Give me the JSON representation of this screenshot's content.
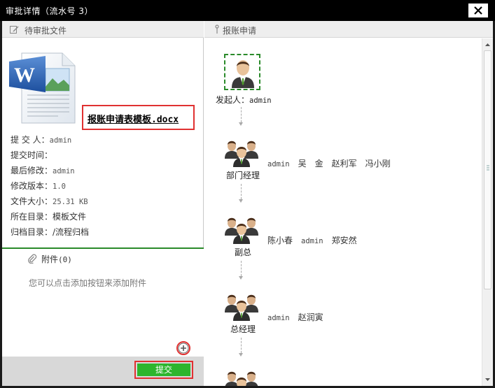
{
  "window": {
    "title": "审批详情（流水号 3）",
    "close_label": "✕"
  },
  "left_panel": {
    "header": "待审批文件",
    "file_name": "报账申请表模板.docx",
    "meta": [
      {
        "key": "提 交 人：",
        "value": "admin"
      },
      {
        "key": "提交时间：",
        "value": ""
      },
      {
        "key": "最后修改：",
        "value": "admin"
      },
      {
        "key": "修改版本：",
        "value": "1.0"
      },
      {
        "key": "文件大小：",
        "value": "25.31 KB"
      },
      {
        "key": "所在目录：",
        "value": "模板文件"
      },
      {
        "key": "归档目录：",
        "value": "/流程归档"
      }
    ],
    "attachments": {
      "title": "附件",
      "count": "(0)",
      "hint": "您可以点击添加按钮来添加附件"
    },
    "submit_label": "提交"
  },
  "right_panel": {
    "header": "报账申请",
    "initiator": {
      "label": "发起人：",
      "value": "admin"
    },
    "steps": [
      {
        "label": "部门经理",
        "approvers": [
          "admin",
          "吴　金",
          "赵利军",
          "冯小刚"
        ]
      },
      {
        "label": "副总",
        "approvers": [
          "陈小春",
          "admin",
          "郑安然"
        ]
      },
      {
        "label": "总经理",
        "approvers": [
          "admin",
          "赵润寅"
        ]
      },
      {
        "label": "",
        "approvers": []
      }
    ]
  },
  "colors": {
    "title_bar": "#000000",
    "highlight_border": "#e03131",
    "submit_green": "#2db52d",
    "divider_green": "#2a8a2a"
  },
  "icons": {
    "edit": "edit-icon",
    "paperclip": "paperclip-icon",
    "add": "add-circle-icon",
    "word_doc": "word-document-icon",
    "user": "user-icon",
    "group": "user-group-icon"
  }
}
